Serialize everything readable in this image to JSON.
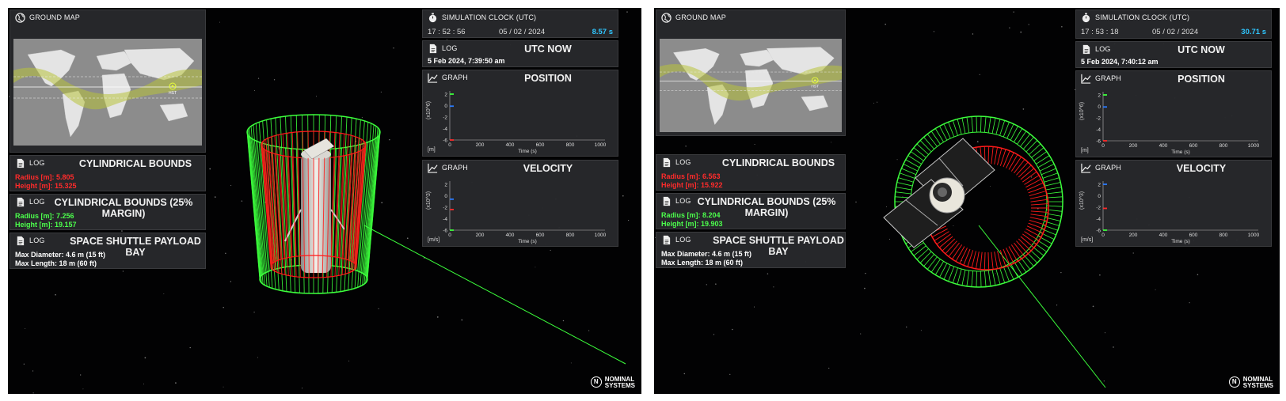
{
  "views": [
    {
      "ground_map": {
        "label": "GROUND MAP",
        "satellite_label": "HST"
      },
      "clock": {
        "label": "SIMULATION CLOCK (UTC)",
        "time": "17 : 52 : 56",
        "date": "05 / 02 / 2024",
        "speed": "8.57 s"
      },
      "utc_log": {
        "tag": "LOG",
        "title": "UTC NOW",
        "value": "5 Feb 2024, 7:39:50 am"
      },
      "position_graph": {
        "tag": "GRAPH",
        "title": "POSITION",
        "y_scale": "(x10^6)",
        "unit": "[m]",
        "x_label": "Time (s)",
        "y_ticks": [
          "2",
          "0",
          "-2",
          "-4",
          "-6"
        ],
        "x_ticks": [
          "0",
          "200",
          "400",
          "600",
          "800",
          "1000"
        ]
      },
      "velocity_graph": {
        "tag": "GRAPH",
        "title": "VELOCITY",
        "y_scale": "(x10^3)",
        "unit": "[m/s]",
        "x_label": "Time (s)",
        "y_ticks": [
          "2",
          "0",
          "-2",
          "-4",
          "-6"
        ],
        "x_ticks": [
          "0",
          "200",
          "400",
          "600",
          "800",
          "1000"
        ]
      },
      "bounds": {
        "tag": "LOG",
        "title": "CYLINDRICAL BOUNDS",
        "radius": "Radius [m]: 5.805",
        "height": "Height [m]: 15.325"
      },
      "bounds_margin": {
        "tag": "LOG",
        "title": "CYLINDRICAL BOUNDS (25% MARGIN)",
        "radius": "Radius [m]: 7.256",
        "height": "Height [m]: 19.157"
      },
      "payload_bay": {
        "tag": "LOG",
        "title": "SPACE SHUTTLE PAYLOAD BAY",
        "diameter": "Max Diameter: 4.6 m (15 ft)",
        "length": "Max Length: 18 m (60 ft)"
      },
      "brand": {
        "line1": "NOMINAL",
        "line2": "SYSTEMS"
      }
    },
    {
      "ground_map": {
        "label": "GROUND MAP",
        "satellite_label": "HST"
      },
      "clock": {
        "label": "SIMULATION CLOCK (UTC)",
        "time": "17 : 53 : 18",
        "date": "05 / 02 / 2024",
        "speed": "30.71 s"
      },
      "utc_log": {
        "tag": "LOG",
        "title": "UTC NOW",
        "value": "5 Feb 2024, 7:40:12 am"
      },
      "position_graph": {
        "tag": "GRAPH",
        "title": "POSITION",
        "y_scale": "(x10^6)",
        "unit": "[m]",
        "x_label": "Time (s)",
        "y_ticks": [
          "2",
          "0",
          "-2",
          "-4",
          "-6"
        ],
        "x_ticks": [
          "0",
          "200",
          "400",
          "600",
          "800",
          "1000"
        ]
      },
      "velocity_graph": {
        "tag": "GRAPH",
        "title": "VELOCITY",
        "y_scale": "(x10^3)",
        "unit": "[m/s]",
        "x_label": "Time (s)",
        "y_ticks": [
          "2",
          "0",
          "-2",
          "-4",
          "-6"
        ],
        "x_ticks": [
          "0",
          "200",
          "400",
          "600",
          "800",
          "1000"
        ]
      },
      "bounds": {
        "tag": "LOG",
        "title": "CYLINDRICAL BOUNDS",
        "radius": "Radius [m]: 6.563",
        "height": "Height [m]: 15.922"
      },
      "bounds_margin": {
        "tag": "LOG",
        "title": "CYLINDRICAL BOUNDS (25% MARGIN)",
        "radius": "Radius [m]: 8.204",
        "height": "Height [m]: 19.903"
      },
      "payload_bay": {
        "tag": "LOG",
        "title": "SPACE SHUTTLE PAYLOAD BAY",
        "diameter": "Max Diameter: 4.6 m (15 ft)",
        "length": "Max Length: 18 m (60 ft)"
      },
      "brand": {
        "line1": "NOMINAL",
        "line2": "SYSTEMS"
      }
    }
  ],
  "colors": {
    "panel_bg": "#28292c",
    "red_text": "#ff2b2b",
    "green_text": "#4cff4c",
    "speed_text": "#2fc6ff",
    "bounds_green": "#3cff3c",
    "bounds_red": "#ff1a1a"
  },
  "icons": [
    "globe-icon",
    "stopwatch-icon",
    "document-icon",
    "graph-icon"
  ]
}
